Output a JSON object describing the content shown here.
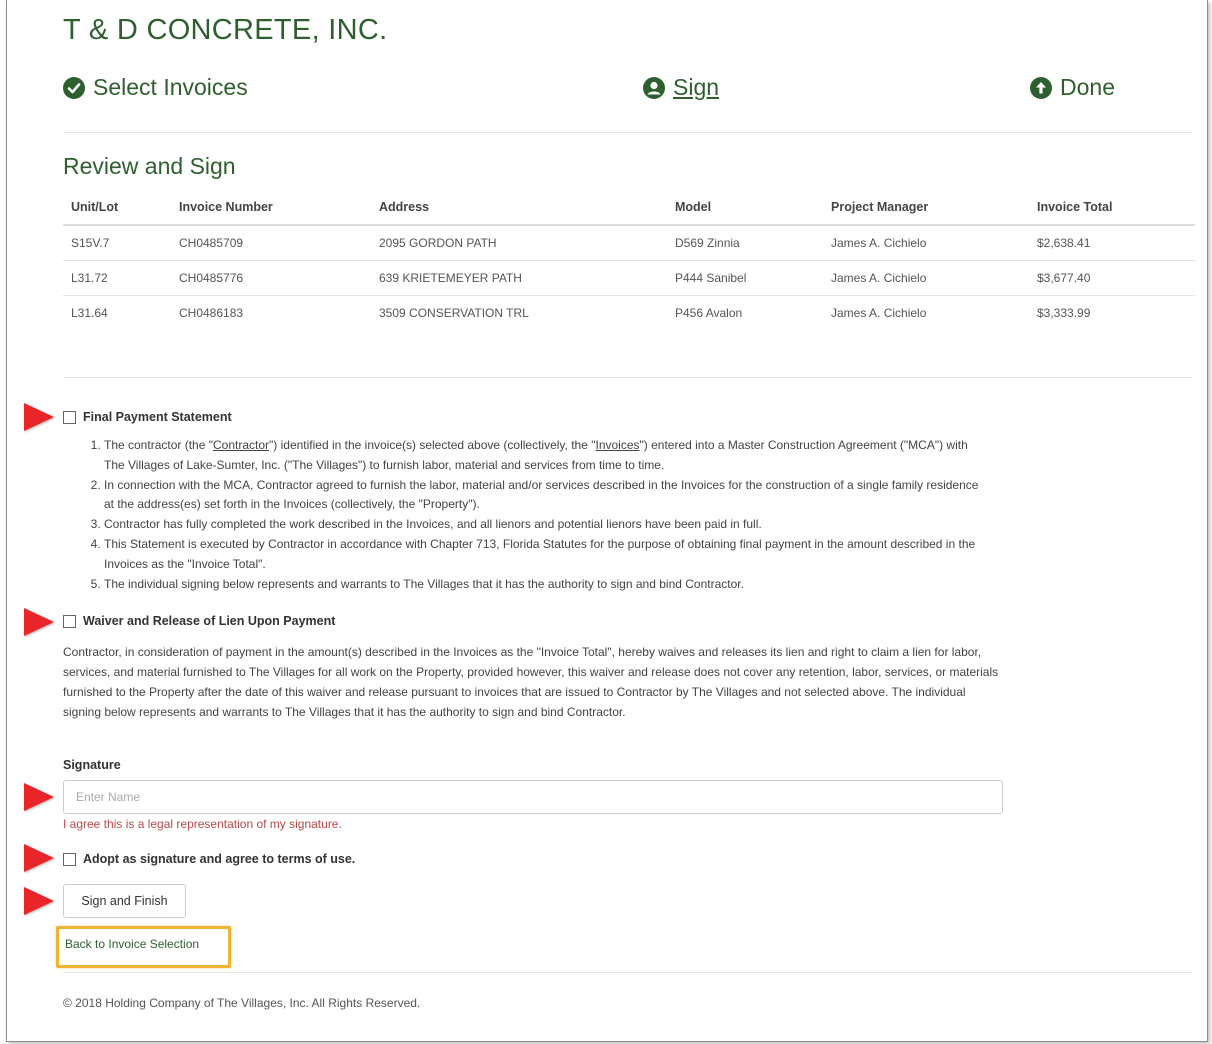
{
  "company_name": "T & D CONCRETE, INC.",
  "steps": [
    {
      "label": "Select Invoices",
      "state": "complete"
    },
    {
      "label": "Sign",
      "state": "current"
    },
    {
      "label": "Done",
      "state": "pending"
    }
  ],
  "section_title": "Review and Sign",
  "table": {
    "headers": [
      "Unit/Lot",
      "Invoice Number",
      "Address",
      "Model",
      "Project Manager",
      "Invoice Total"
    ],
    "rows": [
      [
        "S15V.7",
        "CH0485709",
        "2095 GORDON PATH",
        "D569 Zinnia",
        "James A. Cichielo",
        "$2,638.41"
      ],
      [
        "L31.72",
        "CH0485776",
        "639 KRIETEMEYER PATH",
        "P444 Sanibel",
        "James A. Cichielo",
        "$3,677.40"
      ],
      [
        "L31.64",
        "CH0486183",
        "3509 CONSERVATION TRL",
        "P456 Avalon",
        "James A. Cichielo",
        "$3,333.99"
      ]
    ]
  },
  "final_payment": {
    "label": "Final Payment Statement",
    "items": [
      {
        "pre": "The contractor (the \"",
        "link1": "Contractor",
        "mid": "\") identified in the invoice(s) selected above (collectively, the \"",
        "link2": "Invoices",
        "post": "\") entered into a Master Construction Agreement (\"MCA\") with The Villages of Lake-Sumter, Inc. (\"The Villages\") to furnish labor, material and services from time to time."
      },
      {
        "text": "In connection with the MCA, Contractor agreed to furnish the labor, material and/or services described in the Invoices for the construction of a single family residence at the address(es) set forth in the Invoices (collectively, the \"Property\")."
      },
      {
        "text": "Contractor has fully completed the work described in the Invoices, and all lienors and potential lienors have been paid in full."
      },
      {
        "text": "This Statement is executed by Contractor in accordance with Chapter 713, Florida Statutes for the purpose of obtaining final payment in the amount described in the Invoices as the \"Invoice Total\"."
      },
      {
        "text": "The individual signing below represents and warrants to The Villages that it has the authority to sign and bind Contractor."
      }
    ]
  },
  "waiver": {
    "label": "Waiver and Release of Lien Upon Payment",
    "text": "Contractor, in consideration of payment in the amount(s) described in the Invoices as the \"Invoice Total\", hereby waives and releases its lien and right to claim a lien for labor, services, and material furnished to The Villages for all work on the Property, provided however, this waiver and release does not cover any retention, labor, services, or materials furnished to the Property after the date of this waiver and release pursuant to invoices that are issued to Contractor by The Villages and not selected above. The individual signing below represents and warrants to The Villages that it has the authority to sign and bind Contractor."
  },
  "signature": {
    "label": "Signature",
    "placeholder": "Enter Name",
    "value": "",
    "note": "I agree this is a legal representation of my signature."
  },
  "adopt_label": "Adopt as signature and agree to terms of use.",
  "sign_button": "Sign and Finish",
  "back_link": "Back to Invoice Selection",
  "footer": "© 2018 Holding Company of The Villages, Inc. All Rights Reserved.",
  "colors": {
    "brand_green": "#2e5f2e",
    "arrow_red": "#e8262a",
    "highlight_orange": "#f0b434",
    "error_red": "#b94a48"
  }
}
